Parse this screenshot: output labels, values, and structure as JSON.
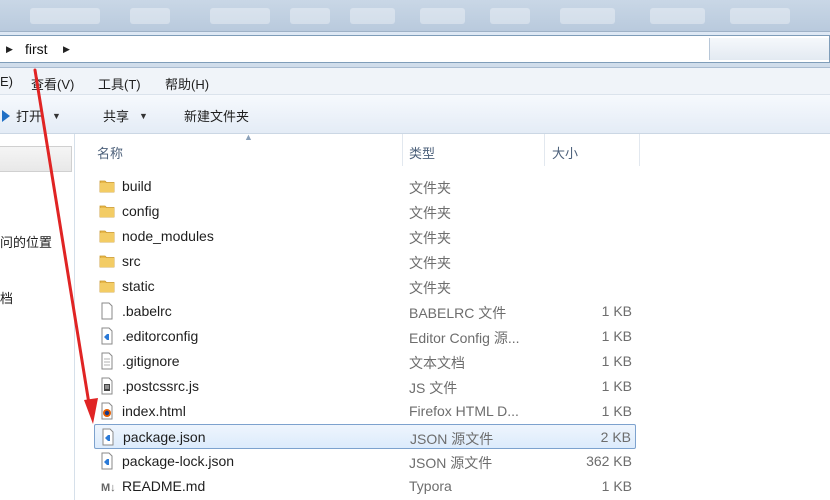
{
  "address": {
    "crumb": "first"
  },
  "menu": {
    "items": [
      "E)",
      "查看(V)",
      "工具(T)",
      "帮助(H)"
    ]
  },
  "commands": {
    "open": "打开",
    "share": "共享",
    "new_folder": "新建文件夹"
  },
  "nav": {
    "items": [
      "问的位置",
      "档"
    ]
  },
  "columns": {
    "name": "名称",
    "type": "类型",
    "size": "大小"
  },
  "files": [
    {
      "name": "build",
      "type": "文件夹",
      "size": "",
      "icon": "folder-icon"
    },
    {
      "name": "config",
      "type": "文件夹",
      "size": "",
      "icon": "folder-icon"
    },
    {
      "name": "node_modules",
      "type": "文件夹",
      "size": "",
      "icon": "folder-icon"
    },
    {
      "name": "src",
      "type": "文件夹",
      "size": "",
      "icon": "folder-icon"
    },
    {
      "name": "static",
      "type": "文件夹",
      "size": "",
      "icon": "folder-icon"
    },
    {
      "name": ".babelrc",
      "type": "BABELRC 文件",
      "size": "1 KB",
      "icon": "blank-file-icon"
    },
    {
      "name": ".editorconfig",
      "type": "Editor Config 源...",
      "size": "1 KB",
      "icon": "vscode-file-icon"
    },
    {
      "name": ".gitignore",
      "type": "文本文档",
      "size": "1 KB",
      "icon": "text-file-icon"
    },
    {
      "name": ".postcssrc.js",
      "type": "JS 文件",
      "size": "1 KB",
      "icon": "js-file-icon"
    },
    {
      "name": "index.html",
      "type": "Firefox HTML D...",
      "size": "1 KB",
      "icon": "firefox-file-icon"
    },
    {
      "name": "package.json",
      "type": "JSON 源文件",
      "size": "2 KB",
      "icon": "vscode-file-icon"
    },
    {
      "name": "package-lock.json",
      "type": "JSON 源文件",
      "size": "362 KB",
      "icon": "vscode-file-icon"
    },
    {
      "name": "README.md",
      "type": "Typora",
      "size": "1 KB",
      "icon": "markdown-file-icon"
    }
  ],
  "selected_file": "package.json",
  "colors": {
    "folder": "#e8b84a",
    "selection_border": "#7da2ce",
    "annotation_arrow": "#e02424"
  }
}
